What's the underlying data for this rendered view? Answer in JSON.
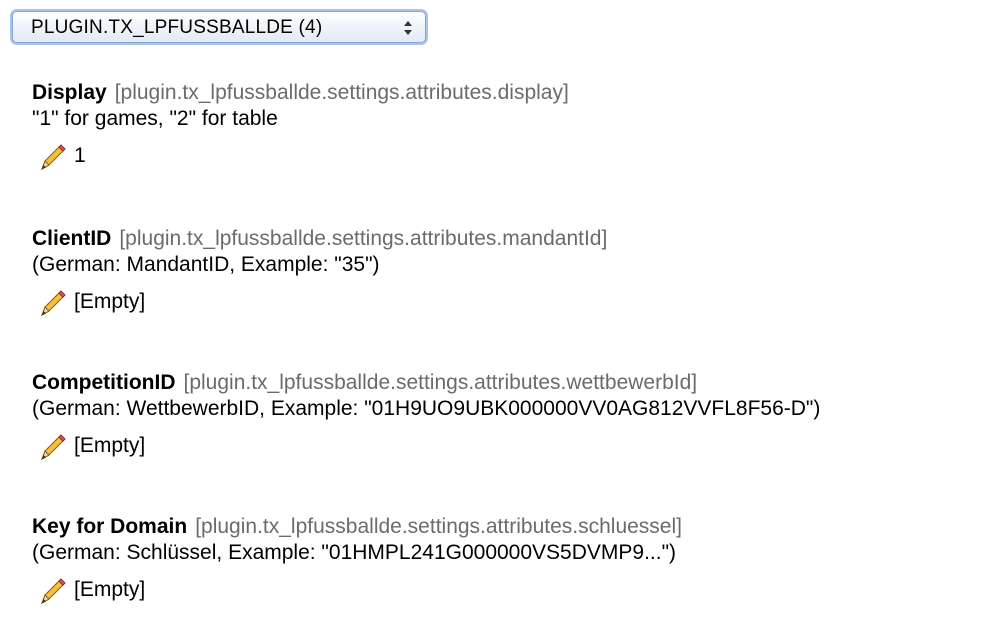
{
  "selector": {
    "label": "PLUGIN.TX_LPFUSSBALLDE (4)"
  },
  "entries": [
    {
      "title": "Display",
      "key": "[plugin.tx_lpfussballde.settings.attributes.display]",
      "description": "\"1\" for games, \"2\" for table",
      "value": "1"
    },
    {
      "title": "ClientID",
      "key": "[plugin.tx_lpfussballde.settings.attributes.mandantId]",
      "description": "(German: MandantID, Example: \"35\")",
      "value": "[Empty]"
    },
    {
      "title": "CompetitionID",
      "key": "[plugin.tx_lpfussballde.settings.attributes.wettbewerbId]",
      "description": "(German: WettbewerbID, Example: \"01H9UO9UBK000000VV0AG812VVFL8F56-D\")",
      "value": "[Empty]"
    },
    {
      "title": "Key for Domain",
      "key": "[plugin.tx_lpfussballde.settings.attributes.schluessel]",
      "description": "(German: Schlüssel, Example: \"01HMPL241G000000VS5DVMP9...\")",
      "value": "[Empty]"
    }
  ],
  "icons": {
    "edit": "pencil-icon",
    "dropdown": "up-down-arrows-icon"
  }
}
